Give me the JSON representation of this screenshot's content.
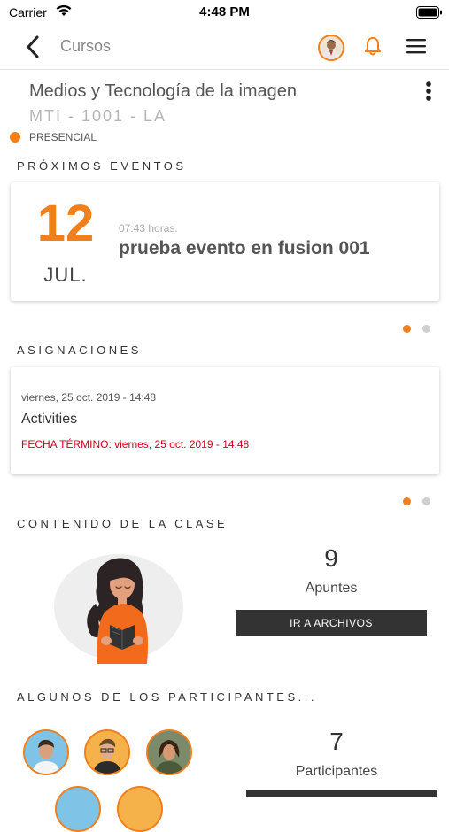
{
  "status_bar": {
    "carrier": "Carrier",
    "time": "4:48 PM"
  },
  "nav": {
    "back_label": "Cursos"
  },
  "course": {
    "title": "Medios y Tecnología de la imagen",
    "code": "MTI - 1001 - LA",
    "modality": "PRESENCIAL"
  },
  "events": {
    "section_title": "PRÓXIMOS EVENTOS",
    "day": "12",
    "month": "JUL.",
    "time": "07:43 horas.",
    "name": "prueba evento en fusion 001"
  },
  "assignments": {
    "section_title": "ASIGNACIONES",
    "date": "viernes, 25 oct. 2019 - 14:48",
    "name": "Activities",
    "due": "FECHA TÉRMINO: viernes, 25 oct. 2019 - 14:48"
  },
  "content": {
    "section_title": "CONTENIDO DE LA CLASE",
    "count": "9",
    "label": "Apuntes",
    "button": "IR A ARCHIVOS"
  },
  "participants": {
    "section_title": "ALGUNOS DE LOS PARTICIPANTES...",
    "count": "7",
    "label": "Participantes"
  },
  "colors": {
    "accent": "#f07f1c",
    "due_red": "#d0021b",
    "button_dark": "#333333"
  }
}
